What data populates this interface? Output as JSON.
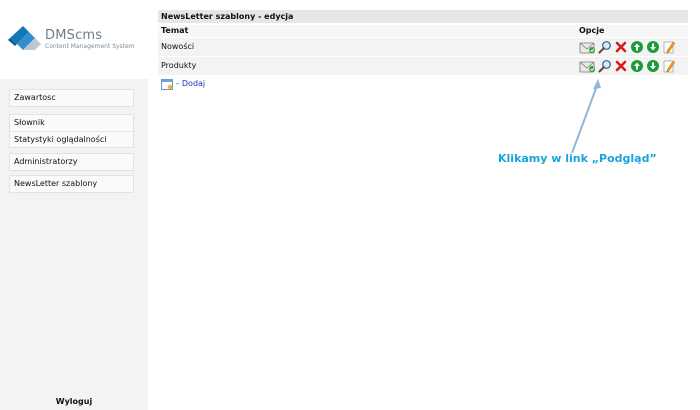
{
  "logo": {
    "title": "DMScms",
    "subtitle": "Content Management System"
  },
  "sidebar": {
    "groups": [
      {
        "items": [
          {
            "label": "Zawartosc"
          }
        ]
      },
      {
        "items": [
          {
            "label": "Słownik"
          },
          {
            "label": "Statystyki oglądalności"
          }
        ]
      },
      {
        "items": [
          {
            "label": "Administratorzy"
          }
        ]
      },
      {
        "items": [
          {
            "label": "NewsLetter szablony"
          }
        ]
      }
    ],
    "logout_label": "Wyloguj"
  },
  "main": {
    "title": "NewsLetter szablony - edycja",
    "columns": {
      "topic": "Temat",
      "options": "Opcje"
    },
    "rows": [
      {
        "topic": "Nowości"
      },
      {
        "topic": "Produkty"
      }
    ],
    "add_dash": "-",
    "add_label": "Dodaj",
    "row_icons": [
      "send-envelope-icon",
      "preview-magnifier-icon",
      "delete-icon",
      "move-up-icon",
      "move-down-icon",
      "edit-pencil-icon"
    ]
  },
  "annotation": {
    "text": "Klikamy w link „Podgląd”"
  },
  "colors": {
    "accent_link": "#1f2dbf",
    "annotation": "#1aa3dc",
    "delete_red": "#d61b1b",
    "arrow_green": "#1e9a3a"
  }
}
